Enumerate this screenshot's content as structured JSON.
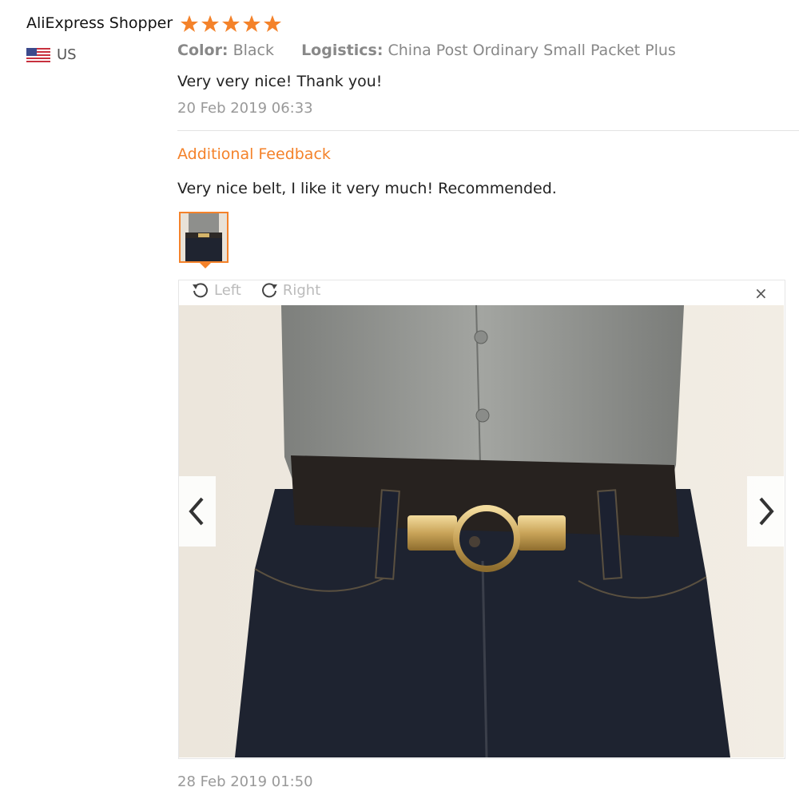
{
  "reviewer": {
    "name": "AliExpress Shopper",
    "country": "US",
    "rating": 5
  },
  "review": {
    "color_label": "Color:",
    "color_value": "Black",
    "logistics_label": "Logistics:",
    "logistics_value": "China Post Ordinary Small Packet Plus",
    "text": "Very very nice! Thank you!",
    "date": "20 Feb 2019 06:33"
  },
  "additional": {
    "title": "Additional Feedback",
    "text": "Very nice belt, I like it very much! Recommended.",
    "date": "28 Feb 2019 01:50"
  },
  "viewer": {
    "rotate_left": "Left",
    "rotate_right": "Right",
    "close": "×"
  },
  "colors": {
    "accent": "#f4822a",
    "star": "#f4822a"
  },
  "icons": {
    "rotate_left": "rotate-left-icon",
    "rotate_right": "rotate-right-icon",
    "prev": "chevron-left-icon",
    "next": "chevron-right-icon",
    "close": "close-icon",
    "flag": "us-flag-icon"
  }
}
